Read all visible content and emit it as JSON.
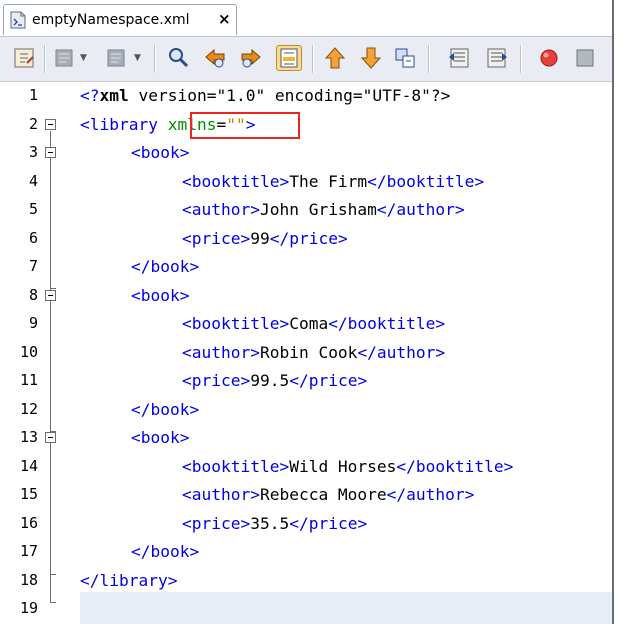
{
  "tab": {
    "title": "emptyNamespace.xml",
    "close": "×"
  },
  "toolbar": {
    "icons": [
      "last-edit-icon",
      "back-icon",
      "forward-icon",
      "find-icon",
      "find-previous-icon",
      "find-next-icon",
      "toggle-highlight-icon",
      "previous-bookmark-icon",
      "next-bookmark-icon",
      "toggle-bookmark-icon",
      "shift-left-icon",
      "shift-right-icon",
      "record-macro-icon",
      "stop-macro-icon"
    ]
  },
  "colors": {
    "tag": "#0000e6",
    "attr": "#009000",
    "value": "#ce7b00",
    "highlight_box": "#e8281e"
  },
  "editor": {
    "lines": [
      {
        "n": "1"
      },
      {
        "n": "2"
      },
      {
        "n": "3"
      },
      {
        "n": "4"
      },
      {
        "n": "5"
      },
      {
        "n": "6"
      },
      {
        "n": "7"
      },
      {
        "n": "8"
      },
      {
        "n": "9"
      },
      {
        "n": "10"
      },
      {
        "n": "11"
      },
      {
        "n": "12"
      },
      {
        "n": "13"
      },
      {
        "n": "14"
      },
      {
        "n": "15"
      },
      {
        "n": "16"
      },
      {
        "n": "17"
      },
      {
        "n": "18"
      },
      {
        "n": "19"
      }
    ],
    "code": {
      "decl_open": "<?",
      "decl_name": "xml",
      "decl_rest": " version=\"1.0\" encoding=\"UTF-8\"?>",
      "library_open": "<library",
      "xmlns_attr": "xmlns",
      "xmlns_eq": "=",
      "xmlns_val": "\"\"",
      "library_close": ">",
      "book_open": "<book>",
      "book_close": "</book>",
      "booktitle_open": "<booktitle>",
      "booktitle_close": "</booktitle>",
      "author_open": "<author>",
      "author_close": "</author>",
      "price_open": "<price>",
      "price_close": "</price>",
      "library_end": "</library>",
      "books": [
        {
          "title": "The Firm",
          "author": "John Grisham",
          "price": "99"
        },
        {
          "title": "Coma",
          "author": "Robin Cook",
          "price": "99.5"
        },
        {
          "title": "Wild Horses",
          "author": "Rebecca Moore",
          "price": "35.5"
        }
      ]
    }
  }
}
